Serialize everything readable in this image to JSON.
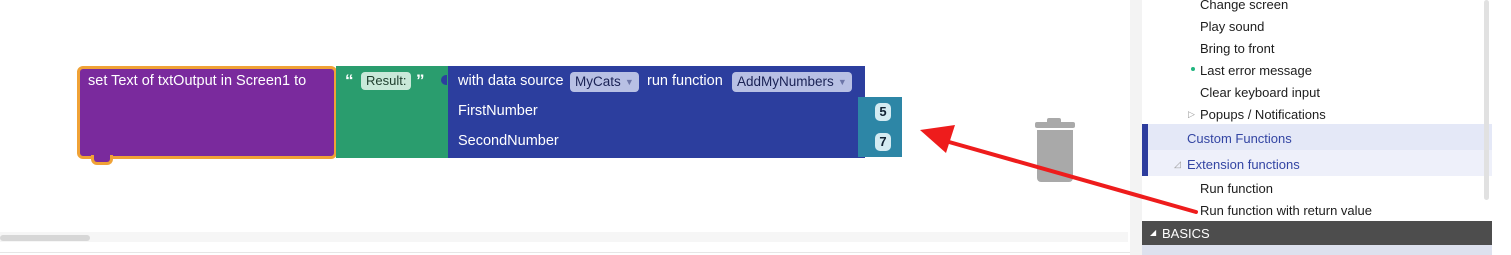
{
  "workspace": {
    "set_block": {
      "label": "set Text of txtOutput in Screen1 to"
    },
    "text_block": {
      "open_quote": "“",
      "value": "Result:",
      "close_quote": "”"
    },
    "call_block": {
      "with_data_source": "with data source",
      "data_source": "MyCats",
      "run_function": "run function",
      "function_name": "AddMyNumbers",
      "param1_label": "FirstNumber",
      "param2_label": "SecondNumber"
    },
    "param1_value": "5",
    "param2_value": "7"
  },
  "panel": {
    "items": [
      {
        "label": "Change screen"
      },
      {
        "label": "Play sound"
      },
      {
        "label": "Bring to front"
      },
      {
        "label": "Last error message"
      },
      {
        "label": "Clear keyboard input"
      },
      {
        "label": "Popups / Notifications"
      }
    ],
    "custom_functions": "Custom Functions",
    "extension_functions": "Extension functions",
    "ext_items": [
      {
        "label": "Run function"
      },
      {
        "label": "Run function with return value"
      }
    ],
    "basics": "BASICS"
  },
  "colors": {
    "set_block": "#7a2a9d",
    "set_block_border": "#f0a236",
    "text_block": "#2a9d6e",
    "call_block": "#2c3e9e",
    "number_block": "#2d86a6",
    "arrow": "#ee1c1c",
    "category_bar": "#2e3d9e"
  },
  "icons": {
    "trash": "trash-can-icon",
    "arrow": "red-arrow-annotation",
    "dropdown": "caret-down-icon",
    "expand": "triangle-right-icon",
    "collapse": "triangle-down-icon"
  }
}
